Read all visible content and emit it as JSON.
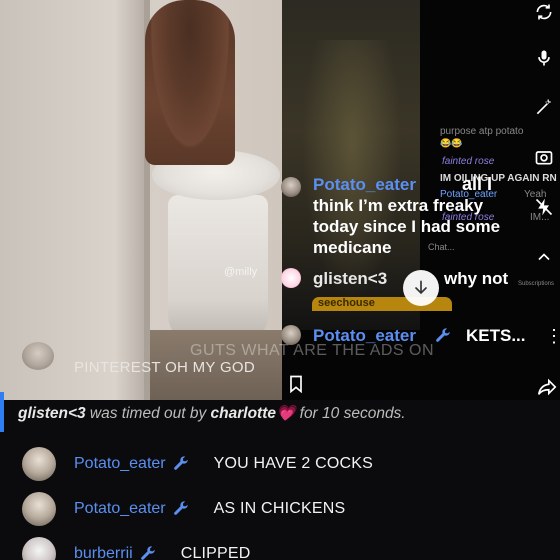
{
  "video": {
    "watermark": "@milly",
    "caption_faint": "GUTS WHAT ARE THE ADS ON",
    "caption": "PINTEREST OH MY GOD"
  },
  "overlay_chat": {
    "top_text": "purpose atp potato",
    "faintedrose_1": "fainted rose",
    "oiling": "IM OILING UP AGAIN RN",
    "potato_small": "Potato_eater",
    "all_text": "all I",
    "yeah": "Yeah",
    "faintedrose_2": "fainted rose",
    "im_dots": "IM...",
    "chat_label": "Chat...",
    "subscriptions": "Subscriptions",
    "line1": {
      "name": "Potato_eater",
      "text1": "think I’m extra freaky",
      "text2": "today since I had some",
      "text3": "medicane"
    },
    "line2": {
      "name": "glisten<3",
      "text": "why not"
    },
    "pill": "seechouse",
    "line3": {
      "name": "Potato_eater",
      "text": "KETS..."
    }
  },
  "rail_icons": [
    "rotate-icon",
    "mic-icon",
    "magic-wand-icon",
    "camera-icon",
    "flash-off-icon",
    "chevron-up-icon"
  ],
  "chat": {
    "timeout": {
      "user": "glisten<3",
      "mid": " was timed out by ",
      "by": "charlotte",
      "heart": "💗",
      "tail": " for 10 seconds."
    },
    "messages": [
      {
        "user": "Potato_eater",
        "text": "YOU HAVE 2 COCKS"
      },
      {
        "user": "Potato_eater",
        "text": "AS IN CHICKENS"
      },
      {
        "user": "burberrii",
        "text": "CLIPPED"
      }
    ]
  },
  "colors": {
    "username": "#5b8ff0",
    "timeout_accent": "#2f7ff3",
    "background": "#0b0b0d"
  }
}
